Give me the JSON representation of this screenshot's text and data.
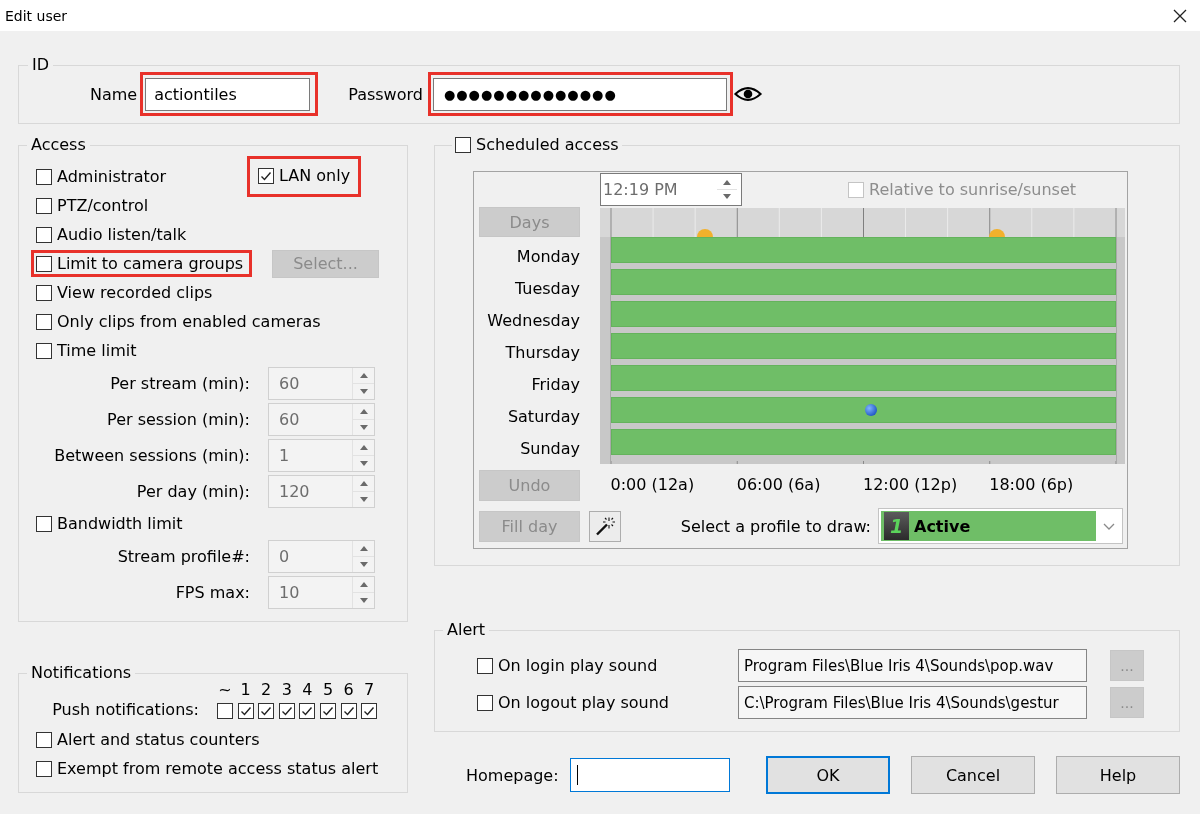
{
  "window": {
    "title": "Edit user"
  },
  "id": {
    "title": "ID",
    "name": {
      "label": "Name",
      "value": "actiontiles",
      "highlighted": true
    },
    "password": {
      "label": "Password",
      "value": "●●●●●●●●●●●●●●",
      "highlighted": true
    }
  },
  "access": {
    "title": "Access",
    "rows": [
      {
        "kind": "checkbox",
        "label": "Administrator",
        "checked": false,
        "highlighted": false,
        "aside": {
          "kind": "checkbox",
          "label": "LAN only",
          "checked": true,
          "highlighted": true
        }
      },
      {
        "kind": "checkbox",
        "label": "PTZ/control",
        "checked": false,
        "highlighted": false
      },
      {
        "kind": "checkbox",
        "label": "Audio listen/talk",
        "checked": false,
        "highlighted": false
      },
      {
        "kind": "checkbox",
        "label": "Limit to camera groups",
        "checked": false,
        "highlighted": true,
        "aside": {
          "kind": "button",
          "label": "Select...",
          "disabled": true
        }
      },
      {
        "kind": "checkbox",
        "label": "View recorded clips",
        "checked": false,
        "highlighted": false
      },
      {
        "kind": "checkbox",
        "label": "Only clips from enabled cameras",
        "checked": false,
        "highlighted": false
      },
      {
        "kind": "checkbox",
        "label": "Time limit",
        "checked": false,
        "highlighted": false
      },
      {
        "kind": "spinner",
        "label": "Per stream (min):",
        "value": "60",
        "disabled": true
      },
      {
        "kind": "spinner",
        "label": "Per session (min):",
        "value": "60",
        "disabled": true
      },
      {
        "kind": "spinner",
        "label": "Between sessions (min):",
        "value": "1",
        "disabled": true
      },
      {
        "kind": "spinner",
        "label": "Per day (min):",
        "value": "120",
        "disabled": true
      },
      {
        "kind": "checkbox",
        "label": "Bandwidth limit",
        "checked": false,
        "highlighted": false
      },
      {
        "kind": "spinner",
        "label": "Stream profile#:",
        "value": "0",
        "disabled": true
      },
      {
        "kind": "spinner",
        "label": "FPS max:",
        "value": "10",
        "disabled": true
      }
    ]
  },
  "notifications": {
    "title": "Notifications",
    "push": {
      "label": "Push notifications:",
      "channels": [
        {
          "label": "~",
          "checked": false
        },
        {
          "label": "1",
          "checked": true
        },
        {
          "label": "2",
          "checked": true
        },
        {
          "label": "3",
          "checked": true
        },
        {
          "label": "4",
          "checked": true
        },
        {
          "label": "5",
          "checked": true
        },
        {
          "label": "6",
          "checked": true
        },
        {
          "label": "7",
          "checked": true
        }
      ]
    },
    "options": [
      {
        "label": "Alert and status counters",
        "checked": false
      },
      {
        "label": "Exempt from remote access status alert",
        "checked": false
      }
    ]
  },
  "schedule": {
    "label": "Scheduled access",
    "checked": false,
    "time": {
      "value": "12:19 PM",
      "disabled": true
    },
    "relative": {
      "label": "Relative to sunrise/sunset",
      "checked": false,
      "disabled": true
    },
    "days_button": {
      "label": "Days",
      "disabled": true
    },
    "days": [
      {
        "name": "Monday",
        "level": 1,
        "current": false
      },
      {
        "name": "Tuesday",
        "level": 1,
        "current": false
      },
      {
        "name": "Wednesday",
        "level": 1,
        "current": false
      },
      {
        "name": "Thursday",
        "level": 1,
        "current": false
      },
      {
        "name": "Friday",
        "level": 1,
        "current": false
      },
      {
        "name": "Saturday",
        "level": 1,
        "current": true
      },
      {
        "name": "Sunday",
        "level": 1,
        "current": false
      }
    ],
    "axis_labels": [
      "0:00 (12a)",
      "06:00 (6a)",
      "12:00 (12p)",
      "18:00 (6p)"
    ],
    "undo_button": {
      "label": "Undo",
      "disabled": true
    },
    "fill_day_button": {
      "label": "Fill day",
      "disabled": true
    },
    "profile": {
      "label": "Select a profile to draw:",
      "number": "1",
      "name": "Active"
    }
  },
  "alert": {
    "title": "Alert",
    "rows": [
      {
        "label": "On login play sound",
        "checked": false,
        "path": "Program Files\\Blue Iris 4\\Sounds\\pop.wav",
        "browse": {
          "label": "...",
          "disabled": true
        }
      },
      {
        "label": "On logout play sound",
        "checked": false,
        "path": "C:\\Program Files\\Blue Iris 4\\Sounds\\gestur",
        "browse": {
          "label": "...",
          "disabled": true
        }
      }
    ]
  },
  "homepage": {
    "label": "Homepage:",
    "focused": true
  },
  "buttons": [
    {
      "label": "OK",
      "default": true
    },
    {
      "label": "Cancel",
      "default": false
    },
    {
      "label": "Help",
      "default": false
    }
  ]
}
